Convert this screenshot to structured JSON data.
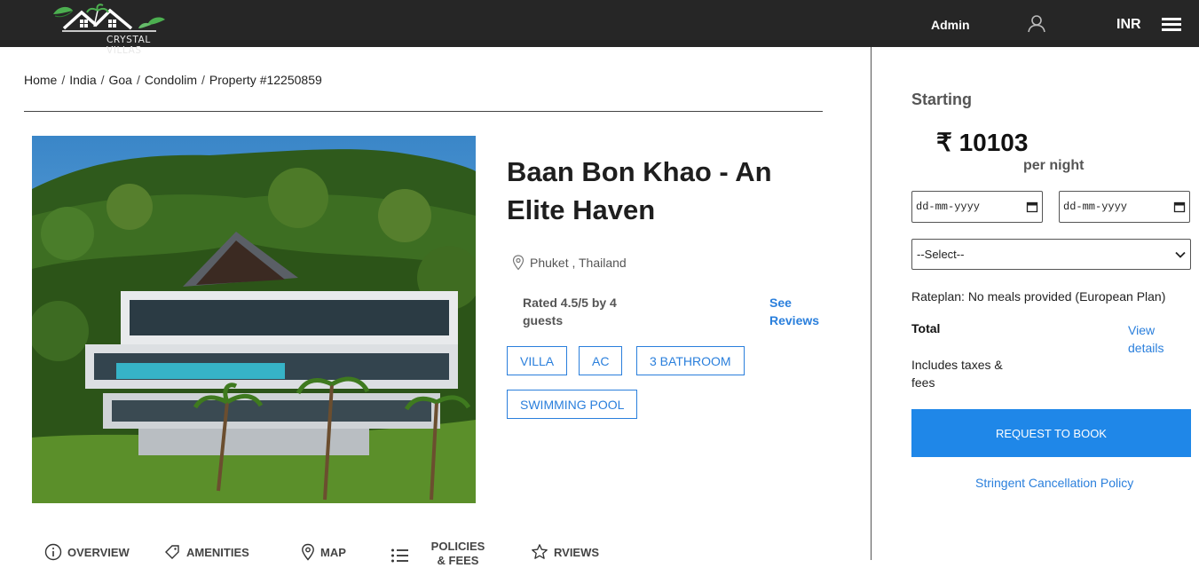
{
  "header": {
    "logo_text": "CRYSTAL VILLAS",
    "admin_label": "Admin",
    "user_icon": "user-icon",
    "currency": "INR",
    "menu_icon": "hamburger-menu-icon"
  },
  "breadcrumb": {
    "items": [
      "Home",
      "India",
      "Goa",
      "Condolim",
      "Property #12250859"
    ],
    "separator": "/"
  },
  "property": {
    "image_alt": "villa-photo",
    "title": "Baan Bon Khao - An Elite Haven",
    "location": "Phuket , Thailand",
    "rating_text": "Rated 4.5/5 by 4 guests",
    "see_reviews": "See Reviews",
    "tags": [
      "VILLA",
      "AC",
      "3 BATHROOM",
      "SWIMMING POOL"
    ]
  },
  "tabs": [
    {
      "label": "OVERVIEW",
      "icon": "info-icon"
    },
    {
      "label": "AMENITIES",
      "icon": "tag-icon"
    },
    {
      "label": "MAP",
      "icon": "map-pin-icon"
    },
    {
      "label": "POLICIES & FEES",
      "icon": "list-icon"
    },
    {
      "label": "RVIEWS",
      "icon": "star-icon"
    }
  ],
  "booking": {
    "starting_label": "Starting",
    "price": "₹ 10103",
    "per_night": "per night",
    "checkin_placeholder": "dd-mm-yyyy",
    "checkout_placeholder": "dd-mm-yyyy",
    "select_value": "--Select--",
    "rateplan": "Rateplan: No meals provided (European Plan)",
    "total_label": "Total",
    "view_details": "View details",
    "includes": "Includes taxes & fees",
    "request_button": "REQUEST TO BOOK",
    "cancellation_link": "Stringent Cancellation Policy"
  },
  "colors": {
    "header_bg": "#262626",
    "accent": "#2a7fdc",
    "button": "#1f87e8"
  }
}
